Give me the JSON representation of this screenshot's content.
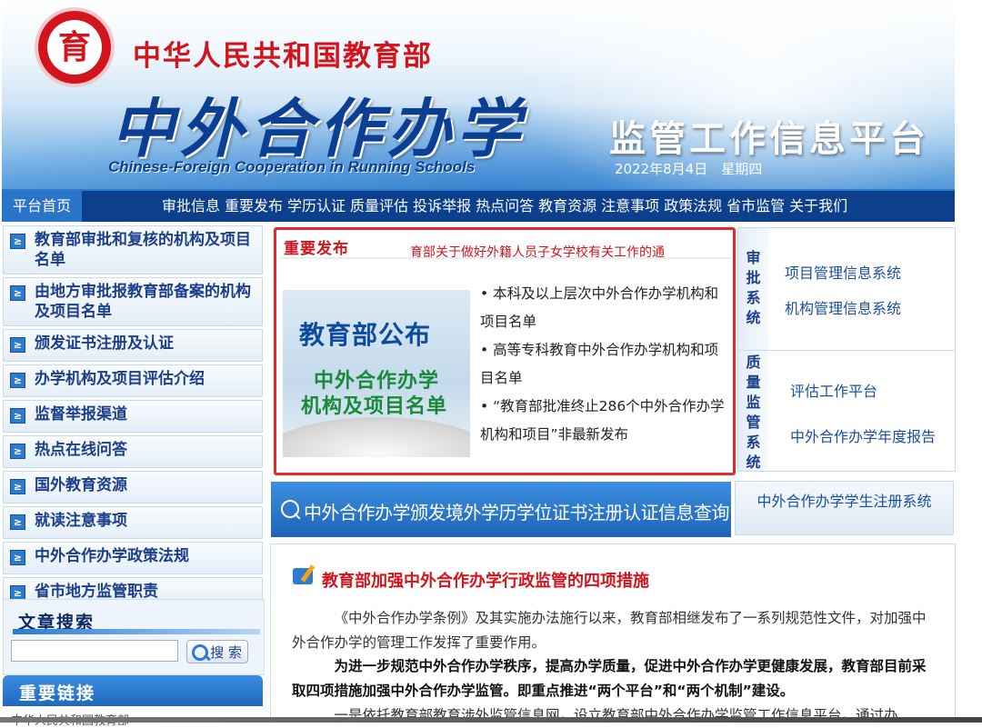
{
  "header": {
    "emblem_glyph": "育",
    "ministry_name": "中华人民共和国教育部",
    "big_title": "中外合作办学",
    "english_title": "Chinese-Foreign Cooperation in Running Schools",
    "platform_title": "监管工作信息平台",
    "date_text": "2022年8月4日　星期四"
  },
  "nav": {
    "home": "平台首页",
    "items": [
      "审批信息",
      "重要发布",
      "学历认证",
      "质量评估",
      "投诉举报",
      "热点问答",
      "教育资源",
      "注意事项",
      "政策法规",
      "省市监管",
      "关于我们"
    ]
  },
  "sidebar": {
    "items": [
      {
        "label": "教育部审批和复核的机构及项目名单"
      },
      {
        "label": "由地方审批报教育部备案的机构及项目名单"
      },
      {
        "label": "颁发证书注册及认证"
      },
      {
        "label": "办学机构及项目评估介绍"
      },
      {
        "label": "监督举报渠道"
      },
      {
        "label": "热点在线问答"
      },
      {
        "label": "国外教育资源"
      },
      {
        "label": "就读注意事项"
      },
      {
        "label": "中外合作办学政策法规"
      },
      {
        "label": "省市地方监管职责"
      }
    ],
    "bullet_glyph": "≥"
  },
  "search": {
    "title": "文章搜索",
    "input_value": "",
    "button_label": "搜 索"
  },
  "links": {
    "title": "重要链接",
    "first_item": "中华人民共和国教育部"
  },
  "release": {
    "tab_label": "重要发布",
    "marquee_text": "育部关于做好外籍人员子女学校有关工作的通",
    "image_text": {
      "line1": "教育部公布",
      "line2": "中外合作办学",
      "line3": "机构及项目名单"
    },
    "items": [
      "• 本科及以上层次中外合作办学机构和项目名单",
      "• 高等专科教育中外合作办学机构和项目名单",
      "• “教育部批准终止286个中外合作办学机构和项目”非最新发布"
    ]
  },
  "systems": {
    "approve_label": "审批系统",
    "approve_links": [
      "项目管理信息系统",
      "机构管理信息系统"
    ],
    "quality_label": "质量监管系统",
    "quality_links": [
      "评估工作平台",
      "中外合作办学年度报告"
    ],
    "student_reg": "中外合作办学学生注册系统"
  },
  "query": {
    "text": "中外合作办学颁发境外学历学位证书注册认证信息查询"
  },
  "article": {
    "title": "教育部加强中外合作办学行政监管的四项措施",
    "p1": "《中外合作办学条例》及其实施办法施行以来，教育部相继发布了一系列规范性文件，对加强中外合作办学的管理工作发挥了重要作用。",
    "p2": "为进一步规范中外合作办学秩序，提高办学质量，促进中外合作办学更健康发展，教育部目前采取四项措施加强中外合作办学监管。即重点推进“两个平台”和“两个机制”建设。",
    "p3": "一是依托教育部教育涉外监管信息网，设立教育部中外合作办学监管工作信息平台，通过办"
  },
  "colors": {
    "brand_blue": "#0c3f8c",
    "accent_red": "#d3141c",
    "link_blue": "#1b4f9c"
  }
}
